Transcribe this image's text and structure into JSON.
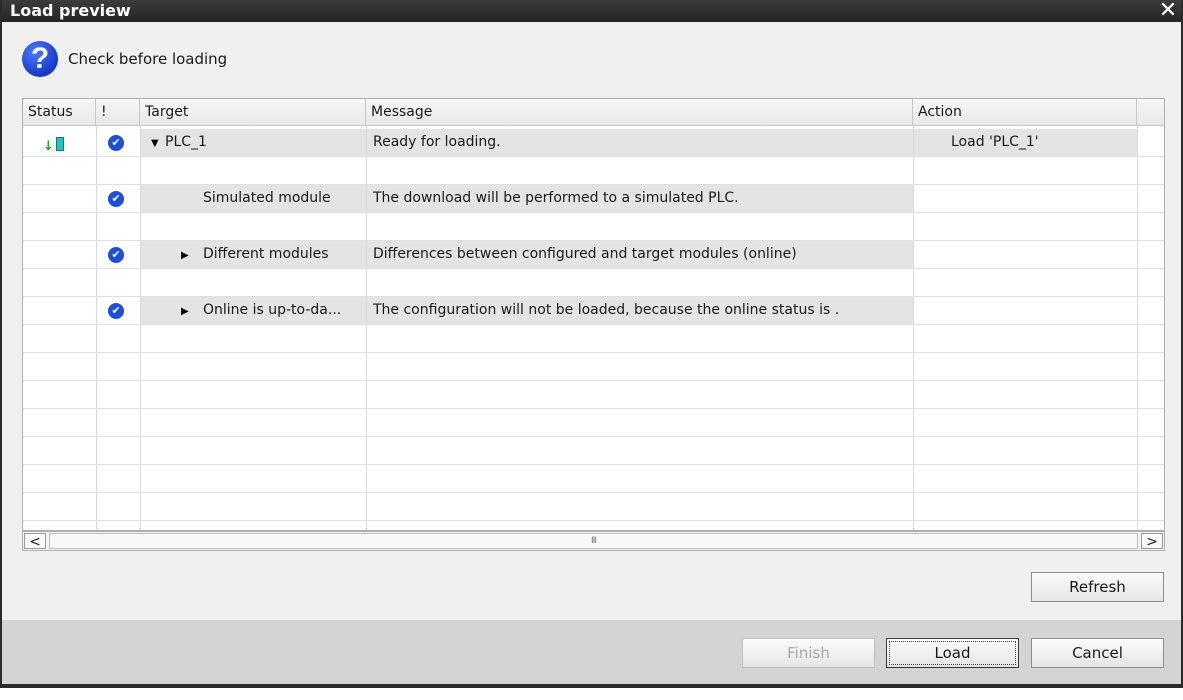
{
  "window": {
    "title": "Load preview",
    "close_glyph": "✕"
  },
  "header": {
    "icon": "help-icon",
    "text": "Check before loading"
  },
  "columns": {
    "status": "Status",
    "flag": "!",
    "target": "Target",
    "message": "Message",
    "action": "Action"
  },
  "rows": [
    {
      "target": "PLC_1",
      "message": "Ready for loading.",
      "action": "Load 'PLC_1'",
      "expander": "expanded",
      "status_icon": "download-plc-icon",
      "flag_icon": "check-icon"
    },
    {
      "target": "Simulated module",
      "message": "The download will be performed to a simulated PLC.",
      "action": "",
      "expander": "none",
      "flag_icon": "check-icon"
    },
    {
      "target": "Different modules",
      "message": "Differences between configured and target modules (online)",
      "action": "",
      "expander": "collapsed",
      "flag_icon": "check-icon"
    },
    {
      "target": "Online is up-to-da...",
      "message": "The configuration will not be loaded, because the online status is .",
      "action": "",
      "expander": "collapsed",
      "flag_icon": "check-icon"
    }
  ],
  "scrollbar": {
    "left": "<",
    "right": ">",
    "thumb": "III"
  },
  "buttons": {
    "refresh": "Refresh",
    "finish": "Finish",
    "load": "Load",
    "cancel": "Cancel"
  },
  "colors": {
    "title_bar": "#2b2b2b",
    "check_icon": "#1f4fd8",
    "help_icon": "#1339c9",
    "footer": "#d4d4d4"
  }
}
